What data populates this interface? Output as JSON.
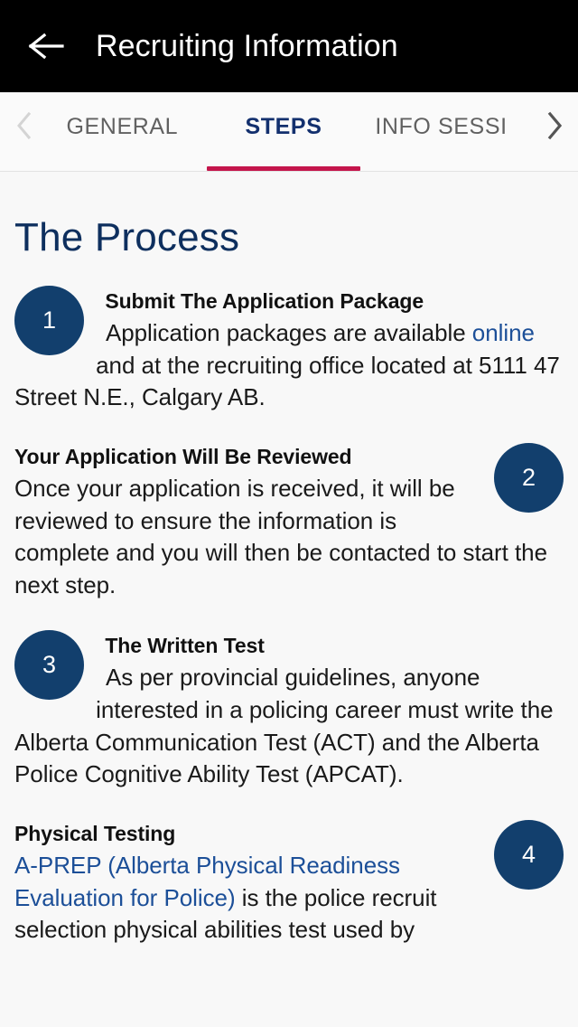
{
  "appbar": {
    "back_icon": "arrow-left-icon",
    "title": "Recruiting Information"
  },
  "tabbar": {
    "prev_icon": "chevron-left-icon",
    "next_icon": "chevron-right-icon",
    "active_index": 1,
    "accent_color": "#c4154b",
    "active_color": "#13306e",
    "inactive_color": "#616161",
    "tabs": [
      {
        "label": "GENERAL"
      },
      {
        "label": "STEPS"
      },
      {
        "label": "INFO SESSI"
      }
    ]
  },
  "content": {
    "page_title": "The Process",
    "badge_color": "#123f6d",
    "link_color": "#1c4f98",
    "steps": [
      {
        "number": "1",
        "badge_side": "left",
        "title": "Submit The Application Package",
        "body_before_link": "Application packages are available ",
        "link_text": "online",
        "body_after_link": " and at the recruiting office located at 5111 47 Street N.E., Calgary AB."
      },
      {
        "number": "2",
        "badge_side": "right",
        "title": "Your Application Will Be Reviewed",
        "body_before_link": "Once your application is received, it will be reviewed to ensure the information is complete and you will then be contacted to start the next step.",
        "link_text": "",
        "body_after_link": ""
      },
      {
        "number": "3",
        "badge_side": "left",
        "title": "The Written Test",
        "body_before_link": "As per provincial guidelines, anyone interested in a policing career must write the Alberta Communication Test (ACT) and the Alberta Police Cognitive Ability Test (APCAT).",
        "link_text": "",
        "body_after_link": ""
      },
      {
        "number": "4",
        "badge_side": "right",
        "title": "Physical Testing",
        "body_before_link": "",
        "link_text": "A-PREP (Alberta Physical Readiness Evaluation for Police)",
        "body_after_link": " is the police recruit selection physical abilities test used by"
      }
    ]
  }
}
